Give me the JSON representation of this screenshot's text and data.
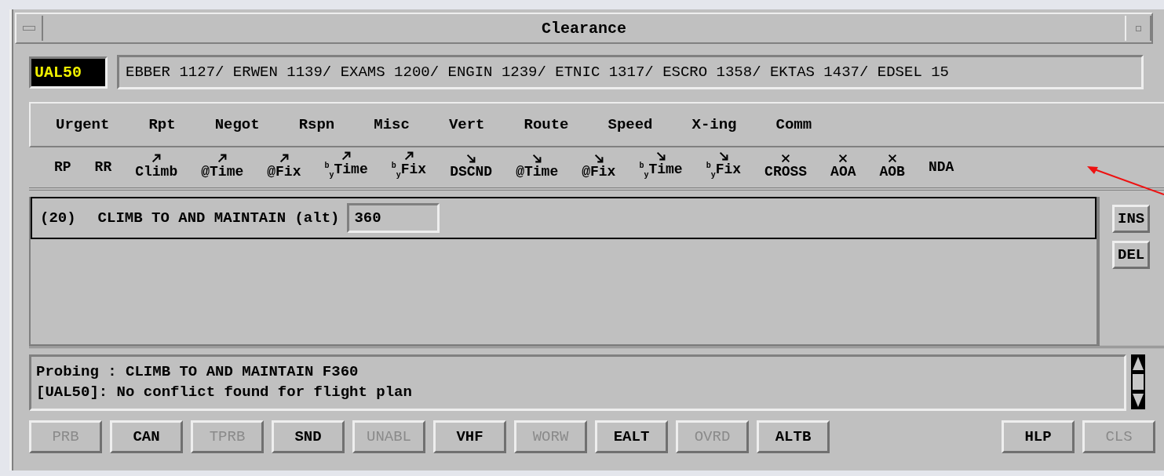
{
  "window": {
    "title": "Clearance"
  },
  "callsign": "UAL50",
  "route": "EBBER 1127/ ERWEN 1139/ EXAMS 1200/ ENGIN 1239/ ETNIC 1317/ ESCRO 1358/ EKTAS 1437/ EDSEL 15",
  "categories": [
    "Urgent",
    "Rpt",
    "Negot",
    "Rspn",
    "Misc",
    "Vert",
    "Route",
    "Speed",
    "X-ing",
    "Comm"
  ],
  "actions": [
    {
      "label": "RP",
      "kind": "plain"
    },
    {
      "label": "RR",
      "kind": "plain"
    },
    {
      "label": "Climb",
      "kind": "climb"
    },
    {
      "label": "@Time",
      "kind": "climb"
    },
    {
      "label": "@Fix",
      "kind": "climb"
    },
    {
      "label": "$^{b}$$_{y}$Time",
      "kind": "climb"
    },
    {
      "label": "$^{b}$$_{y}$Fix",
      "kind": "climb"
    },
    {
      "label": "DSCND",
      "kind": "descend"
    },
    {
      "label": "@Time",
      "kind": "descend"
    },
    {
      "label": "@Fix",
      "kind": "descend"
    },
    {
      "label": "$^{b}$$_{y}$Time",
      "kind": "descend"
    },
    {
      "label": "$^{b}$$_{y}$Fix",
      "kind": "descend"
    },
    {
      "label": "CROSS",
      "kind": "cross"
    },
    {
      "label": "AOA",
      "kind": "cross"
    },
    {
      "label": "AOB",
      "kind": "cross"
    },
    {
      "label": "NDA",
      "kind": "plain"
    }
  ],
  "entries": [
    {
      "number": "(20)",
      "text": "CLIMB TO AND MAINTAIN (alt)",
      "value": "360"
    }
  ],
  "entry_buttons": [
    "INS",
    "DEL"
  ],
  "status_lines": [
    "Probing : CLIMB TO AND MAINTAIN F360",
    "[UAL50]: No conflict found for flight plan"
  ],
  "buttons": [
    {
      "label": "PRB",
      "disabled": true
    },
    {
      "label": "CAN",
      "disabled": false
    },
    {
      "label": "TPRB",
      "disabled": true
    },
    {
      "label": "SND",
      "disabled": false
    },
    {
      "label": "UNABL",
      "disabled": true
    },
    {
      "label": "VHF",
      "disabled": false
    },
    {
      "label": "WORW",
      "disabled": true
    },
    {
      "label": "EALT",
      "disabled": false
    },
    {
      "label": "OVRD",
      "disabled": true
    },
    {
      "label": "ALTB",
      "disabled": false
    }
  ],
  "right_buttons": [
    {
      "label": "HLP",
      "disabled": false
    },
    {
      "label": "CLS",
      "disabled": true
    }
  ]
}
